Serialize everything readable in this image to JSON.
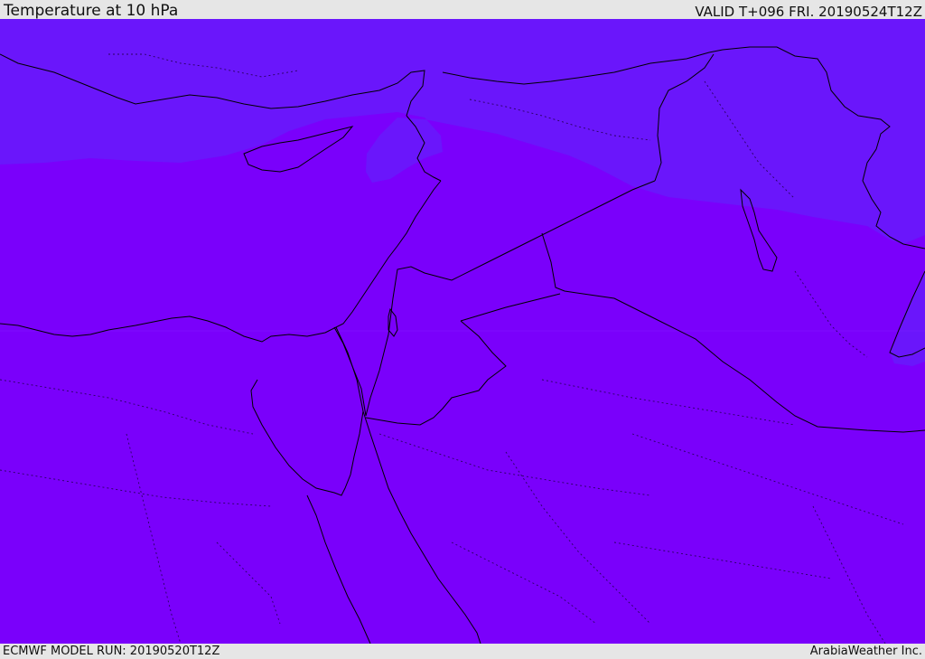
{
  "header": {
    "title": "Temperature at 10 hPa",
    "valid": "VALID T+096 FRI. 20190524T12Z"
  },
  "footer": {
    "model_run": "ECMWF MODEL RUN: 20190520T12Z",
    "credit": "ArabiaWeather Inc."
  },
  "map": {
    "colors": {
      "field_main": "#7a00fb",
      "field_cooler": "#6a16fb",
      "coastline": "#000000",
      "inner_border": "#2a0060"
    }
  }
}
